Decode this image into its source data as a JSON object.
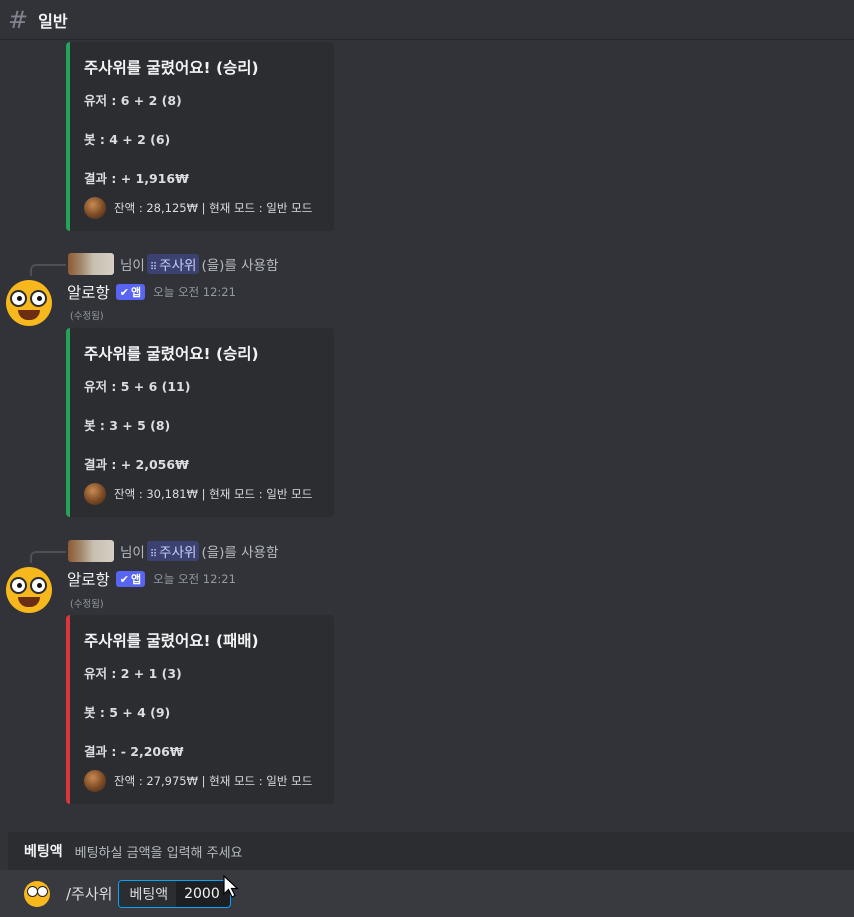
{
  "channel": {
    "name": "일반"
  },
  "embeds": [
    {
      "title": "주사위를 굴렸어요! (승리)",
      "user": "유저 : 6 + 2 (8)",
      "bot": "봇 : 4 + 2 (6)",
      "result": "결과 : + 1,916₩",
      "footer": "잔액 : 28,125₩ | 현재 모드 : 일반 모드",
      "outcome": "win"
    },
    {
      "title": "주사위를 굴렸어요! (승리)",
      "user": "유저 : 5 + 6 (11)",
      "bot": "봇 : 3 + 5 (8)",
      "result": "결과 : + 2,056₩",
      "footer": "잔액 : 30,181₩ | 현재 모드 : 일반 모드",
      "outcome": "win"
    },
    {
      "title": "주사위를 굴렸어요! (패배)",
      "user": "유저 : 2 + 1 (3)",
      "bot": "봇 : 5 + 4 (9)",
      "result": "결과 : - 2,206₩",
      "footer": "잔액 : 27,975₩ | 현재 모드 : 일반 모드",
      "outcome": "loss"
    }
  ],
  "reply": {
    "prefix": "님이",
    "command": "주사위",
    "suffix": "(을)를 사용함"
  },
  "message": {
    "author": "알로항",
    "app_badge": "앱",
    "timestamp": "오늘 오전 12:21",
    "edited": "(수정됨)"
  },
  "hint": {
    "option_name": "베팅액",
    "option_desc": "베팅하실 금액을 입력해 주세요"
  },
  "input": {
    "command": "/주사위",
    "option_label": "베팅액",
    "option_value": "2000"
  },
  "colors": {
    "win": "#23a559",
    "loss": "#da373c",
    "mention_bg": "#3c4270",
    "app_badge": "#5865f2"
  }
}
